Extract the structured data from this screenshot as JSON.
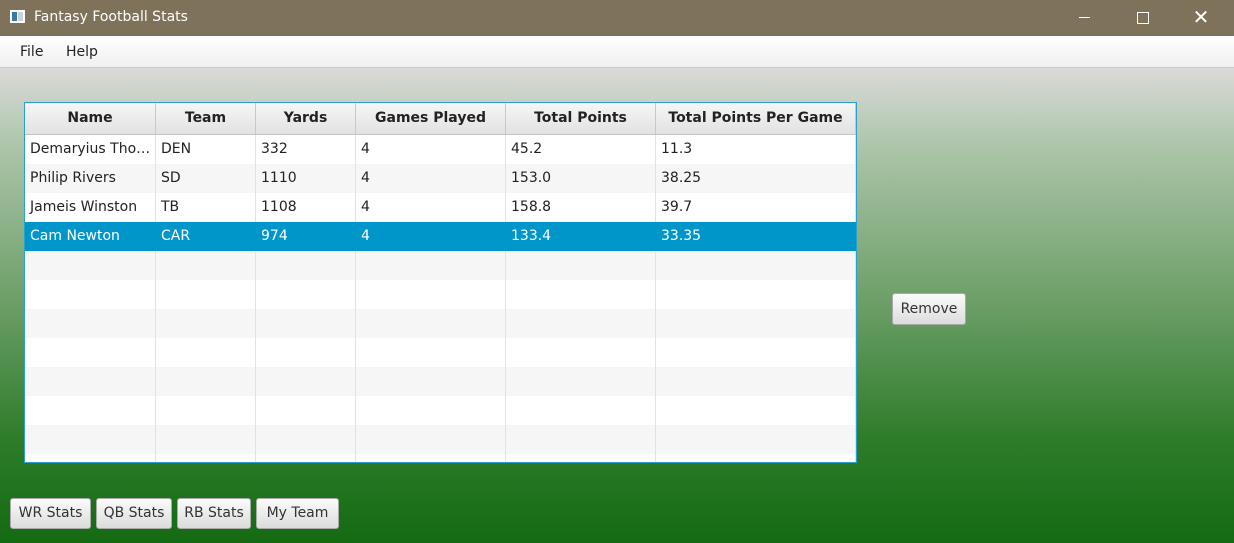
{
  "window": {
    "title": "Fantasy Football Stats",
    "controls": {
      "minimize": "minimize-icon",
      "maximize": "maximize-icon",
      "close": "close-icon"
    }
  },
  "menu": {
    "file": "File",
    "help": "Help"
  },
  "table": {
    "columns": [
      "Name",
      "Team",
      "Yards",
      "Games Played",
      "Total Points",
      "Total Points Per Game"
    ],
    "rows": [
      [
        "Demaryius Tho…",
        "DEN",
        "332",
        "4",
        "45.2",
        "11.3"
      ],
      [
        "Philip Rivers",
        "SD",
        "1110",
        "4",
        "153.0",
        "38.25"
      ],
      [
        "Jameis Winston",
        "TB",
        "1108",
        "4",
        "158.8",
        "39.7"
      ],
      [
        "Cam Newton",
        "CAR",
        "974",
        "4",
        "133.4",
        "33.35"
      ]
    ],
    "selected_row": "Cam Newton",
    "accent_color": "#0096c9"
  },
  "buttons": {
    "remove": "Remove",
    "wr_stats": "WR Stats",
    "qb_stats": "QB Stats",
    "rb_stats": "RB Stats",
    "my_team": "My Team"
  }
}
